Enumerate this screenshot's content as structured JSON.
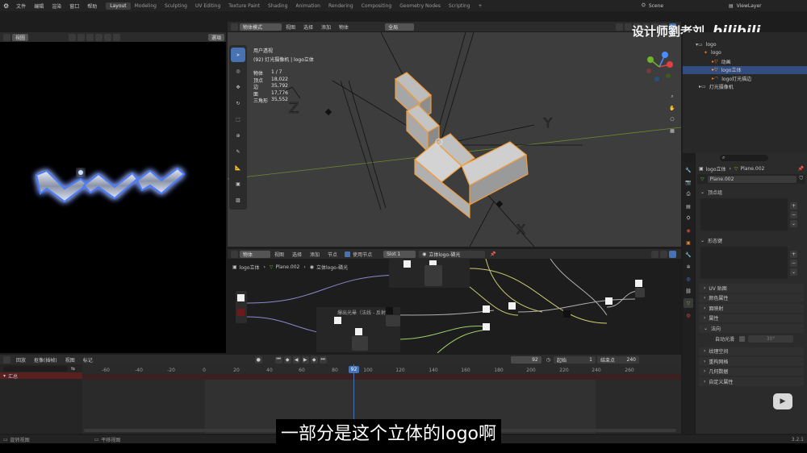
{
  "topbar": {
    "menus": [
      "文件",
      "编辑",
      "渲染",
      "窗口",
      "帮助"
    ],
    "workspaces": [
      "Layout",
      "Modeling",
      "Sculpting",
      "UV Editing",
      "Texture Paint",
      "Shading",
      "Animation",
      "Rendering",
      "Compositing",
      "Geometry Nodes",
      "Scripting"
    ],
    "add_tab": "+",
    "scene": "Scene",
    "view_layer": "ViewLayer"
  },
  "watermark": {
    "text": "设计师劉老刘",
    "logo": "bilibili"
  },
  "render_view": {
    "header_button": "視圖",
    "header_select": "選項"
  },
  "viewport": {
    "mode": "物体模式",
    "menus": [
      "视图",
      "选择",
      "添加",
      "物体"
    ],
    "transform": "全局",
    "overlay_title": "用户透视",
    "overlay_subtitle": "(92) 灯光摄像机 | logo立体",
    "stats": [
      {
        "label": "物体",
        "value": "1 / 7"
      },
      {
        "label": "顶点",
        "value": "18,022"
      },
      {
        "label": "边",
        "value": "35,792"
      },
      {
        "label": "面",
        "value": "17,776"
      },
      {
        "label": "三角形",
        "value": "35,552"
      }
    ],
    "gizmo_axes": {
      "x": "X",
      "y": "Y",
      "z": "Z"
    }
  },
  "outliner": {
    "search_placeholder": "",
    "rows": [
      {
        "label": "logo",
        "depth": 1
      },
      {
        "label": "logo",
        "depth": 2
      },
      {
        "label": "动画",
        "depth": 3
      },
      {
        "label": "logo立体",
        "depth": 3,
        "selected": true
      },
      {
        "label": "logo灯光描边",
        "depth": 3
      },
      {
        "label": "灯光摄像机",
        "depth": 1
      }
    ]
  },
  "node_editor": {
    "mode": "物体",
    "menus": [
      "视图",
      "选择",
      "添加",
      "节点"
    ],
    "use_nodes_label": "使用节点",
    "slot": "Slot 1",
    "material": "立体logo-磷光",
    "breadcrumb": [
      "logo立体",
      "Plane.002",
      "立体logo-磷光"
    ],
    "frame_label": "爆出光晕（法线 - 反射）"
  },
  "properties": {
    "breadcrumb": [
      "logo立体",
      "Plane.002"
    ],
    "mesh_name": "Plane.002",
    "panels": [
      "顶点组",
      "形态键"
    ],
    "collapsed": [
      "UV 贴图",
      "颜色属性",
      "面映射",
      "属性"
    ],
    "normals": {
      "title": "法向",
      "auto_smooth_label": "自动光滑",
      "auto_smooth_value": "30°"
    },
    "more": [
      "纹理空间",
      "重构网格",
      "几何数据",
      "自定义属性"
    ]
  },
  "timeline": {
    "menus": [
      "回放",
      "抠像(插帧)",
      "视图",
      "标记"
    ],
    "current_frame": "92",
    "start_label": "起始",
    "start": "1",
    "end_label": "结束点",
    "end": "240",
    "ticks": [
      "-60",
      "-40",
      "-20",
      "0",
      "20",
      "40",
      "60",
      "80",
      "100",
      "120",
      "140",
      "160",
      "180",
      "200",
      "220",
      "240",
      "260"
    ],
    "track_label": "汇总"
  },
  "statusbar": {
    "left": "旋转视图",
    "middle": "平移视图",
    "right": "3.2.1"
  },
  "subtitle": "一部分是这个立体的logo啊",
  "colors": {
    "accent": "#4772b3",
    "selection": "#f29c38",
    "frame": "#4772b3"
  }
}
